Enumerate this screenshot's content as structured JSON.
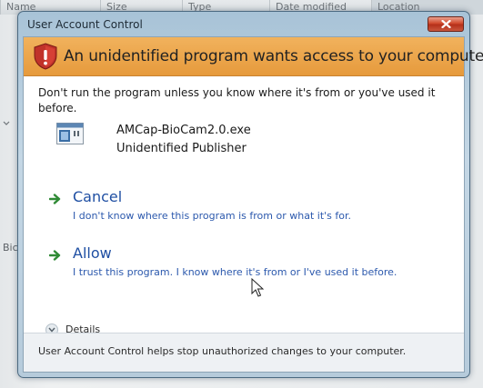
{
  "background_window": {
    "columns": [
      "Name",
      "Size",
      "Type",
      "Date modified",
      "Location"
    ],
    "side_label": "Bic"
  },
  "dialog": {
    "title": "User Account Control",
    "close_icon": "close-icon",
    "banner": {
      "icon": "shield-warning-icon",
      "text": "An unidentified program wants access to your computer"
    },
    "warning": "Don't run the program unless you know where it's from or you've used it before.",
    "program": {
      "icon": "program-icon",
      "name": "AMCap-BioCam2.0.exe",
      "publisher": "Unidentified Publisher"
    },
    "options": [
      {
        "label": "Cancel",
        "description": "I don't know where this program is from or what it's for."
      },
      {
        "label": "Allow",
        "description": "I trust this program. I know where it's from or I've used it before."
      }
    ],
    "details_label": "Details",
    "footer": "User Account Control helps stop unauthorized changes to your computer."
  },
  "colors": {
    "banner": "#e69a3c",
    "link": "#1f4fa3",
    "close_button": "#c9563d"
  }
}
